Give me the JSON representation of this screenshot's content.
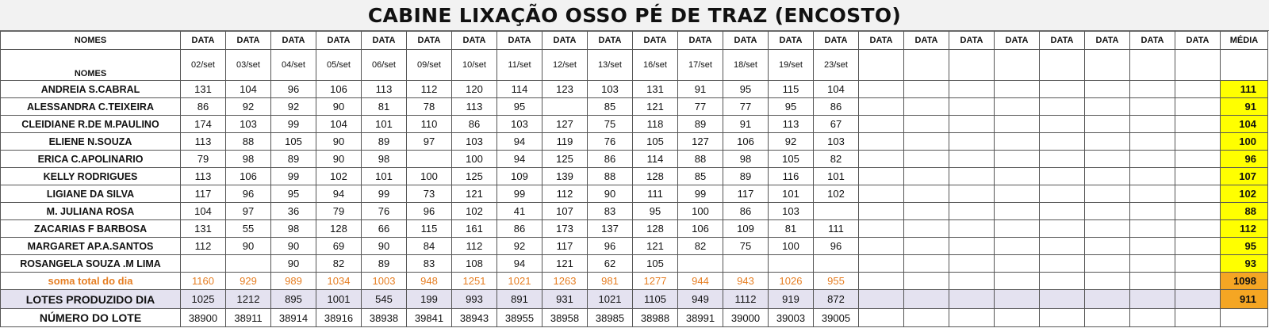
{
  "title": "CABINE LIXAÇÃO OSSO PÉ DE TRAZ (ENCOSTO)",
  "colors": {
    "avg_fill": "#ffff00",
    "sum_text": "#e67e22",
    "sum_avg_fill": "#f5a623",
    "lotes_fill": "#e4e2f0"
  },
  "header": {
    "names_label": "NOMES",
    "data_label": "DATA",
    "avg_label": "MÉDIA",
    "dates": [
      "02/set",
      "03/set",
      "04/set",
      "05/set",
      "06/set",
      "09/set",
      "10/set",
      "11/set",
      "12/set",
      "13/set",
      "16/set",
      "17/set",
      "18/set",
      "19/set",
      "23/set",
      "",
      "",
      "",
      "",
      "",
      "",
      "",
      ""
    ]
  },
  "rows": [
    {
      "name": "ANDREIA S.CABRAL",
      "values": [
        "131",
        "104",
        "96",
        "106",
        "113",
        "112",
        "120",
        "114",
        "123",
        "103",
        "131",
        "91",
        "95",
        "115",
        "104"
      ],
      "avg": "111"
    },
    {
      "name": "ALESSANDRA C.TEIXEIRA",
      "values": [
        "86",
        "92",
        "92",
        "90",
        "81",
        "78",
        "113",
        "95",
        "",
        "85",
        "121",
        "77",
        "77",
        "95",
        "86"
      ],
      "avg": "91"
    },
    {
      "name": "CLEIDIANE R.DE M.PAULINO",
      "values": [
        "174",
        "103",
        "99",
        "104",
        "101",
        "110",
        "86",
        "103",
        "127",
        "75",
        "118",
        "89",
        "91",
        "113",
        "67"
      ],
      "avg": "104"
    },
    {
      "name": "ELIENE N.SOUZA",
      "values": [
        "113",
        "88",
        "105",
        "90",
        "89",
        "97",
        "103",
        "94",
        "119",
        "76",
        "105",
        "127",
        "106",
        "92",
        "103"
      ],
      "avg": "100"
    },
    {
      "name": "ERICA C.APOLINARIO",
      "values": [
        "79",
        "98",
        "89",
        "90",
        "98",
        "",
        "100",
        "94",
        "125",
        "86",
        "114",
        "88",
        "98",
        "105",
        "82"
      ],
      "avg": "96"
    },
    {
      "name": "KELLY RODRIGUES",
      "values": [
        "113",
        "106",
        "99",
        "102",
        "101",
        "100",
        "125",
        "109",
        "139",
        "88",
        "128",
        "85",
        "89",
        "116",
        "101"
      ],
      "avg": "107"
    },
    {
      "name": "LIGIANE DA SILVA",
      "values": [
        "117",
        "96",
        "95",
        "94",
        "99",
        "73",
        "121",
        "99",
        "112",
        "90",
        "111",
        "99",
        "117",
        "101",
        "102"
      ],
      "avg": "102"
    },
    {
      "name": "M. JULIANA ROSA",
      "values": [
        "104",
        "97",
        "36",
        "79",
        "76",
        "96",
        "102",
        "41",
        "107",
        "83",
        "95",
        "100",
        "86",
        "103",
        ""
      ],
      "avg": "88"
    },
    {
      "name": "ZACARIAS F BARBOSA",
      "values": [
        "131",
        "55",
        "98",
        "128",
        "66",
        "115",
        "161",
        "86",
        "173",
        "137",
        "128",
        "106",
        "109",
        "81",
        "111"
      ],
      "avg": "112"
    },
    {
      "name": "MARGARET AP.A.SANTOS",
      "values": [
        "112",
        "90",
        "90",
        "69",
        "90",
        "84",
        "112",
        "92",
        "117",
        "96",
        "121",
        "82",
        "75",
        "100",
        "96"
      ],
      "avg": "95"
    },
    {
      "name": "ROSANGELA SOUZA .M LIMA",
      "values": [
        "",
        "",
        "90",
        "82",
        "89",
        "83",
        "108",
        "94",
        "121",
        "62",
        "105",
        "",
        "",
        "",
        ""
      ],
      "avg": "93"
    }
  ],
  "soma": {
    "label": "soma total  do dia",
    "values": [
      "1160",
      "929",
      "989",
      "1034",
      "1003",
      "948",
      "1251",
      "1021",
      "1263",
      "981",
      "1277",
      "944",
      "943",
      "1026",
      "955"
    ],
    "avg": "1098"
  },
  "lotes": {
    "label": "LOTES PRODUZIDO DIA",
    "values": [
      "1025",
      "1212",
      "895",
      "1001",
      "545",
      "199",
      "993",
      "891",
      "931",
      "1021",
      "1105",
      "949",
      "1112",
      "919",
      "872"
    ],
    "avg": "911"
  },
  "numero": {
    "label": "NÚMERO DO LOTE",
    "values": [
      "38900",
      "38911",
      "38914",
      "38916",
      "38938",
      "39841",
      "38943",
      "38955",
      "38958",
      "38985",
      "38988",
      "38991",
      "39000",
      "39003",
      "39005"
    ]
  }
}
